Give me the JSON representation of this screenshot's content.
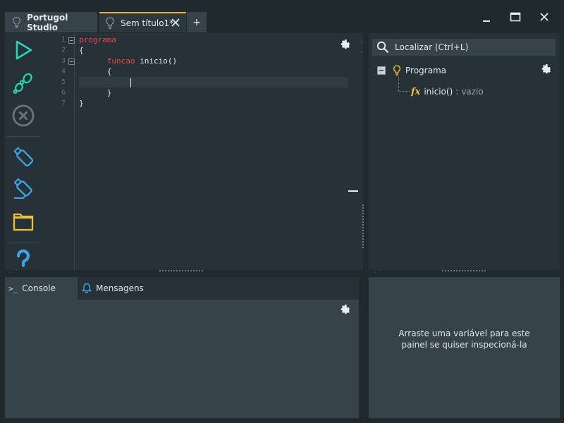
{
  "tabs": {
    "home_label": "Portugol Studio",
    "file_label": "Sem título1*",
    "add_label": "+"
  },
  "window": {
    "icons": [
      "minimize-icon",
      "maximize-icon",
      "close-icon"
    ]
  },
  "toolbar": {
    "icons": [
      "play-icon",
      "step-icon",
      "stop-icon",
      "save-icon",
      "save-as-icon",
      "open-folder-icon",
      "help-icon"
    ],
    "colors": {
      "play": "#1ed7b8",
      "step": "#1ed7b8",
      "stop": "#66757d",
      "save": "#3aa7e8",
      "folder": "#f2c12e",
      "help": "#3aa7e8"
    }
  },
  "editor": {
    "line_numbers": [
      "1",
      "2",
      "3",
      "4",
      "5",
      "6",
      "7"
    ],
    "code": {
      "l1_kw": "programa",
      "l2": "{",
      "l3_kw": "funcao",
      "l3_rest": " inicio()",
      "l4": "{",
      "l6": "}",
      "l7": "}"
    },
    "colors": {
      "keyword": "#ef4545",
      "text": "#dfe6ea"
    }
  },
  "tree": {
    "search_placeholder": "Localizar (Ctrl+L)",
    "root_label": "Programa",
    "child_fx": "fx",
    "child_label": "inicio()",
    "child_sep": ":",
    "child_type": "vazio"
  },
  "console": {
    "prompt_glyph": ">_",
    "console_label": "Console",
    "messages_label": "Mensagens"
  },
  "inspector": {
    "line1": "Arraste uma variável para este",
    "line2": "painel se quiser inspecioná-la"
  }
}
